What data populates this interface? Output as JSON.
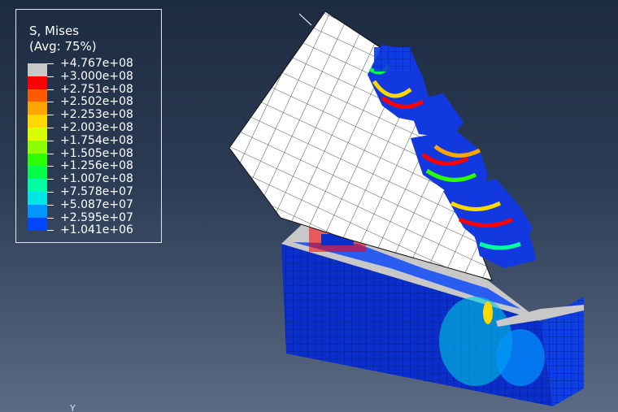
{
  "legend": {
    "title": "S, Mises",
    "subtitle": "(Avg: 75%)",
    "entries": [
      {
        "value": "+4.767e+08",
        "color": "#c8c8c8"
      },
      {
        "value": "+3.000e+08",
        "color": "#ff0000"
      },
      {
        "value": "+2.751e+08",
        "color": "#ff5a00"
      },
      {
        "value": "+2.502e+08",
        "color": "#ffa500"
      },
      {
        "value": "+2.253e+08",
        "color": "#ffd800"
      },
      {
        "value": "+2.003e+08",
        "color": "#d8ff00"
      },
      {
        "value": "+1.754e+08",
        "color": "#8cff00"
      },
      {
        "value": "+1.505e+08",
        "color": "#2eff00"
      },
      {
        "value": "+1.256e+08",
        "color": "#00ff46"
      },
      {
        "value": "+1.007e+08",
        "color": "#00ffa0"
      },
      {
        "value": "+7.578e+07",
        "color": "#00e6e6"
      },
      {
        "value": "+5.087e+07",
        "color": "#0096ff"
      },
      {
        "value": "+2.595e+07",
        "color": "#0046ff"
      },
      {
        "value": "+1.041e+06",
        "color": "#0000d8"
      }
    ]
  },
  "viewport": {
    "axis_label": "Y",
    "colors": {
      "mesh_line": "#1a1a1a",
      "tool_fill": "#ffffff",
      "workpiece_fill": "#0a2fcc",
      "chip_fill": "#1238e0"
    }
  }
}
